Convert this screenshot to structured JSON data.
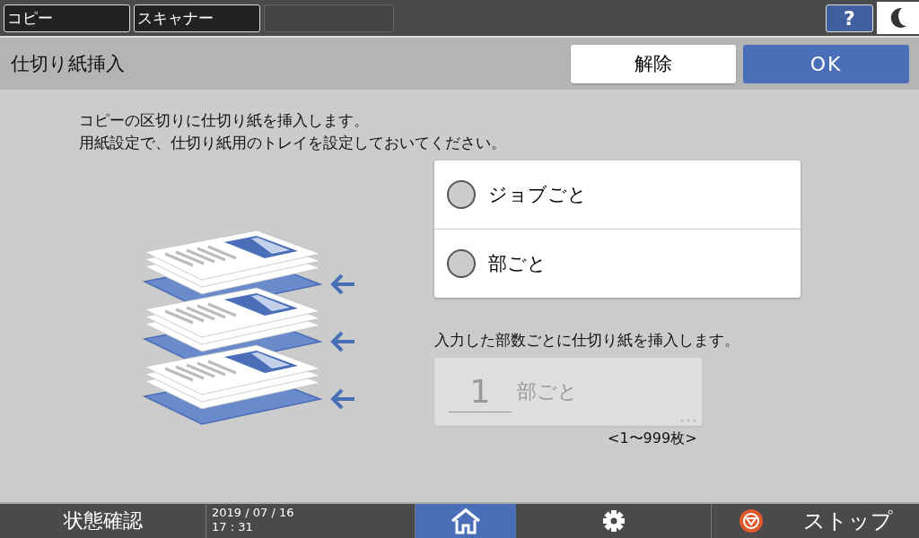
{
  "top_tabs": [
    {
      "label": "コピー",
      "selected": false
    },
    {
      "label": "スキャナー",
      "selected": false
    }
  ],
  "help_button": {
    "label": "?"
  },
  "header": {
    "title": "仕切り紙挿入",
    "cancel_button": "解除",
    "ok_button": "OK"
  },
  "description": [
    "コピーの区切りに仕切り紙を挿入します。",
    "用紙設定で、仕切り紙用のトレイを設定しておいてください。"
  ],
  "options": [
    {
      "label": "ジョブごと",
      "selected": false
    },
    {
      "label": "部ごと",
      "selected": false
    }
  ],
  "copies_field": {
    "hint": "入力した部数ごとに仕切り紙を挿入します。",
    "value": "1",
    "unit": "部ごと",
    "disabled": true,
    "range": "<1〜999枚>"
  },
  "status_bar": {
    "status_button": "状態確認",
    "date": "2019 / 07 / 16",
    "time": "17 : 31",
    "stop_button": "ストップ"
  }
}
